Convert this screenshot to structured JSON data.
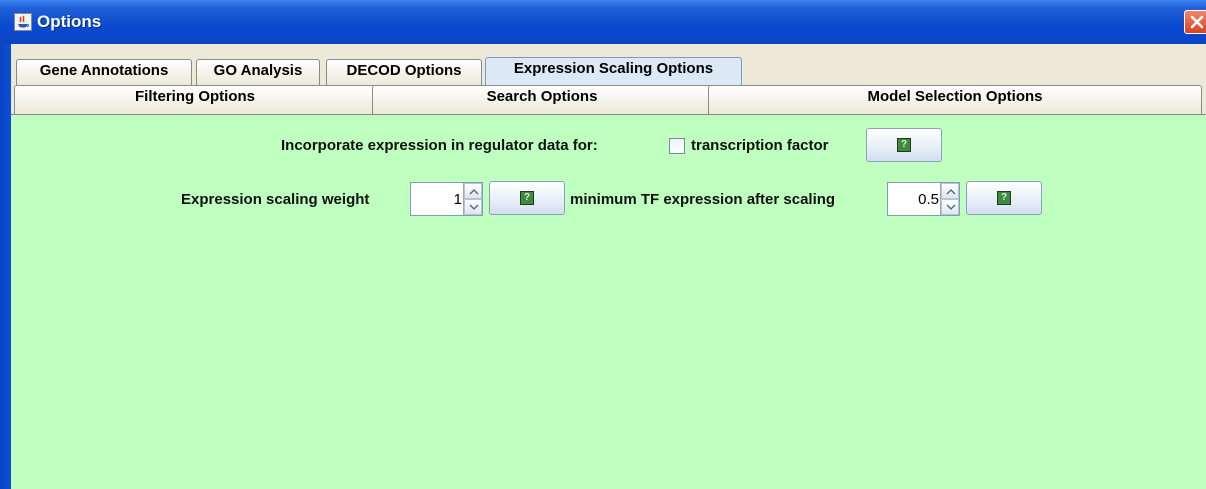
{
  "window": {
    "title": "Options",
    "close_icon": "close-icon"
  },
  "tabs_row1": [
    {
      "label": "Gene Annotations"
    },
    {
      "label": "GO Analysis"
    },
    {
      "label": "DECOD Options"
    },
    {
      "label": "Expression Scaling Options",
      "selected": true
    }
  ],
  "tabs_row2": [
    {
      "label": "Filtering Options"
    },
    {
      "label": "Search Options"
    },
    {
      "label": "Model Selection Options"
    }
  ],
  "panel": {
    "background": "#bfffbf",
    "incorporate_label": "Incorporate expression in regulator data for:",
    "tf_checkbox_label": "transcription factor",
    "tf_checkbox_checked": false,
    "scaling_weight_label": "Expression scaling weight",
    "scaling_weight_value": "1",
    "min_tf_label": "minimum TF expression after scaling",
    "min_tf_value": "0.5",
    "help_icon": "help-icon"
  }
}
